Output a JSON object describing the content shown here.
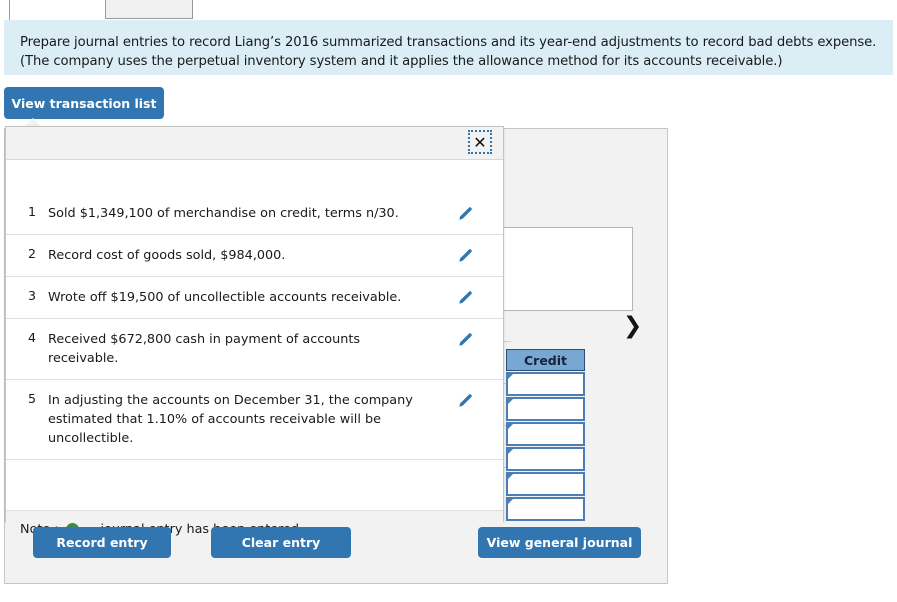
{
  "banner": {
    "text": "Prepare journal entries to record Liang’s 2016 summarized transactions and its year-end adjustments to record bad debts expense. (The company uses the perpetual inventory system and it applies the allowance method for its accounts receivable.)"
  },
  "toolbar": {
    "view_transaction_list": "View transaction list"
  },
  "transaction_popup": {
    "close_label": "✕",
    "rows": [
      {
        "num": "1",
        "desc": "Sold $1,349,100 of merchandise on credit, terms n/30."
      },
      {
        "num": "2",
        "desc": "Record cost of goods sold, $984,000."
      },
      {
        "num": "3",
        "desc": "Wrote off $19,500 of uncollectible accounts receivable."
      },
      {
        "num": "4",
        "desc": "Received $672,800 cash in payment of accounts receivable."
      },
      {
        "num": "5",
        "desc": "In adjusting the accounts on December 31, the company estimated that 1.10% of accounts receivable will be uncollectible."
      }
    ],
    "note_prefix": "Note :",
    "note_suffix": "= journal entry has been entered"
  },
  "journal_panel": {
    "next_chevron": "❯",
    "credit_header": "Credit",
    "credit_cells": [
      "",
      "",
      "",
      "",
      "",
      ""
    ],
    "buttons": {
      "record_entry": "Record entry",
      "clear_entry": "Clear entry",
      "view_general_journal": "View general journal"
    }
  },
  "colors": {
    "accent_blue": "#3276b1",
    "banner_blue": "#dbeef6",
    "table_head_blue": "#79a7d3",
    "green_dot": "#3d8b46",
    "panel_grey": "#f2f2f2"
  }
}
